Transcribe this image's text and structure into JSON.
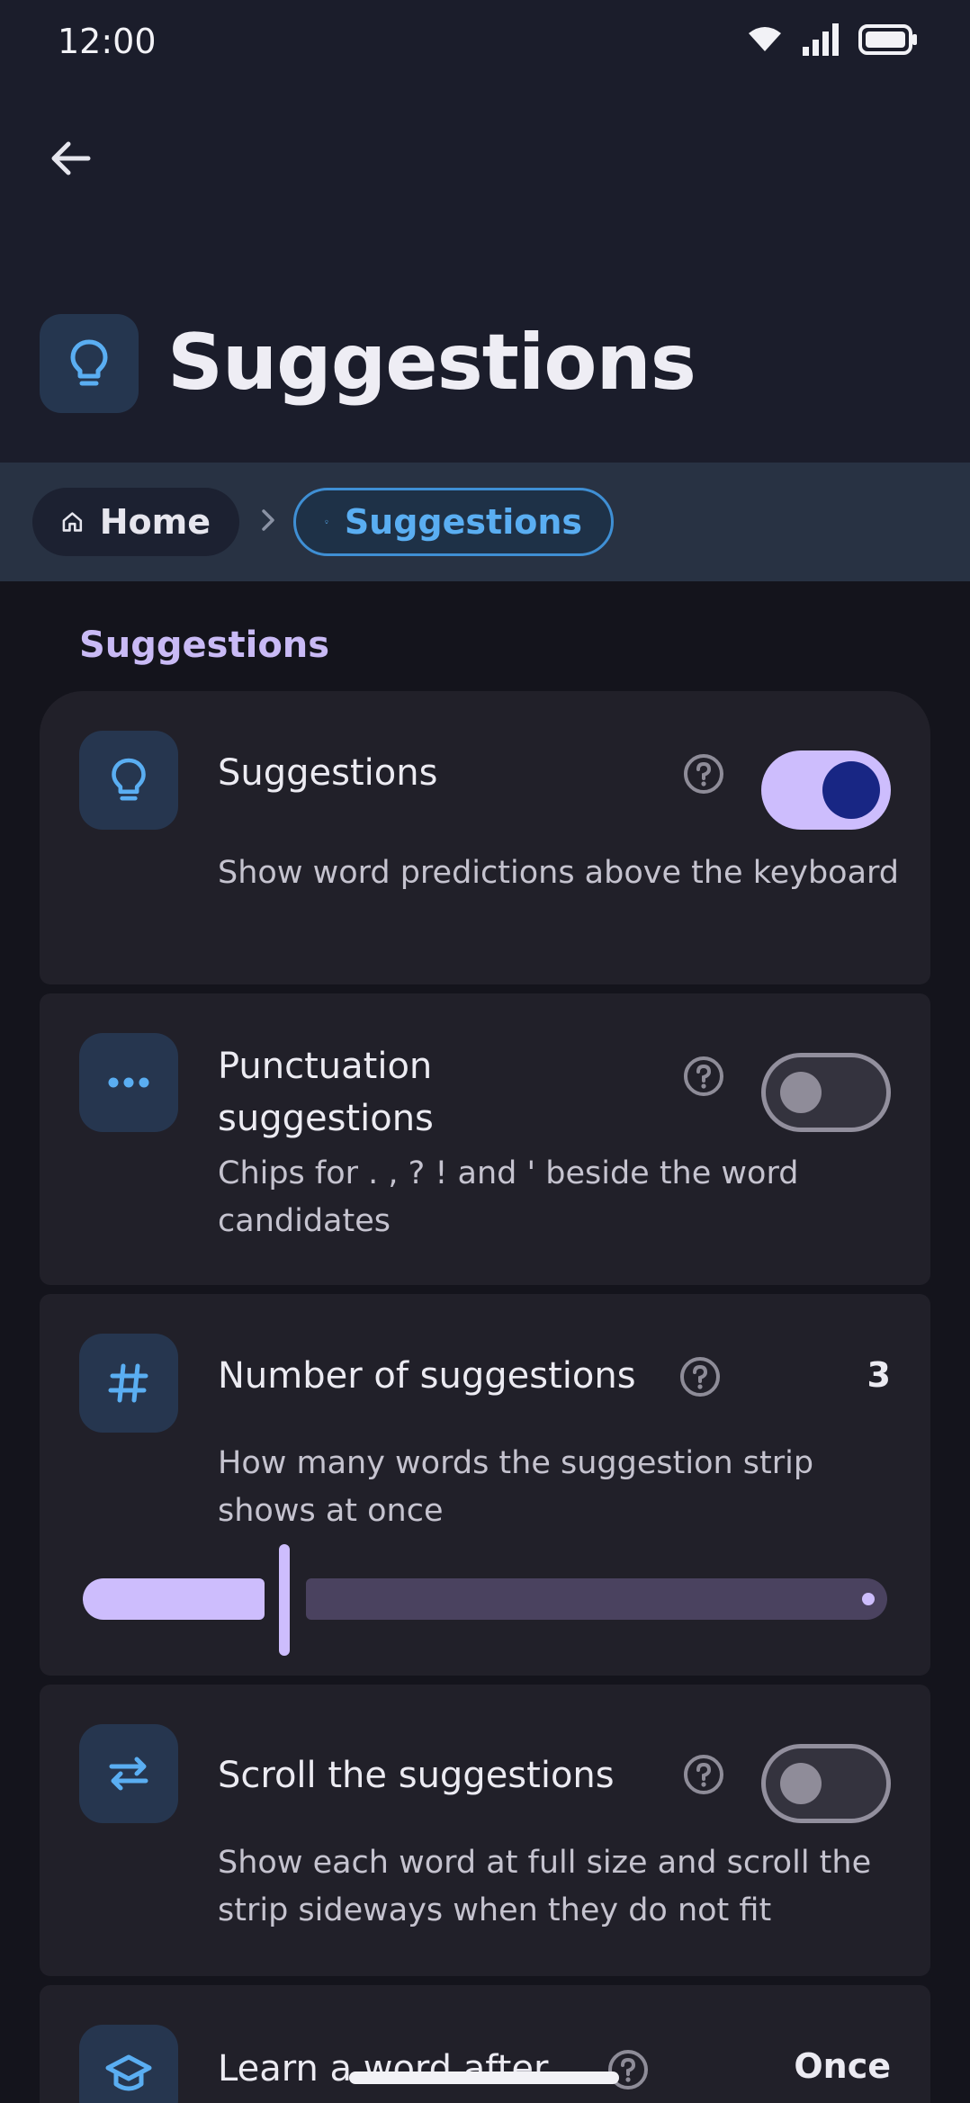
{
  "status_bar": {
    "time": "12:00",
    "icons": [
      "wifi-icon",
      "signal-icon",
      "battery-icon"
    ]
  },
  "app_bar": {
    "back_icon": "arrow-left-icon",
    "title": "Suggestions",
    "title_icon": "lightbulb-icon"
  },
  "breadcrumb": {
    "home": {
      "label": "Home",
      "icon": "home-icon"
    },
    "separator_icon": "chevron-right-icon",
    "current": {
      "label": "Suggestions",
      "icon": "lightbulb-icon"
    }
  },
  "section": {
    "title": "Suggestions"
  },
  "settings": [
    {
      "title": "Suggestions",
      "description": "Show word predictions above the keyboard",
      "icon": "lightbulb-icon",
      "control": "switch",
      "enabled": true
    },
    {
      "title": "Punctuation suggestions",
      "description": "Chips for . , ? ! and ' beside the word candidates",
      "icon": "more-horizontal-icon",
      "control": "switch",
      "enabled": false
    },
    {
      "title": "Number of suggestions",
      "description": "How many words the suggestion strip shows at once",
      "icon": "hash-icon",
      "control": "slider",
      "value": "3",
      "slider_fraction": 0.25
    },
    {
      "title": "Scroll the suggestions",
      "description": "Show each word at full size and scroll the strip sideways when they do not fit",
      "icon": "swap-horizontal-icon",
      "control": "switch",
      "enabled": false
    },
    {
      "title": "Learn a word after",
      "icon": "school-icon",
      "control": "value",
      "value": "Once"
    }
  ],
  "colors": {
    "background": "#14141c",
    "app_bar": "#1b1d2b",
    "breadcrumb_bar": "#283243",
    "card": "#212029",
    "accent_blue": "#5aaef2",
    "accent_lavender": "#cdbdfd",
    "switch_thumb_on": "#182684"
  }
}
